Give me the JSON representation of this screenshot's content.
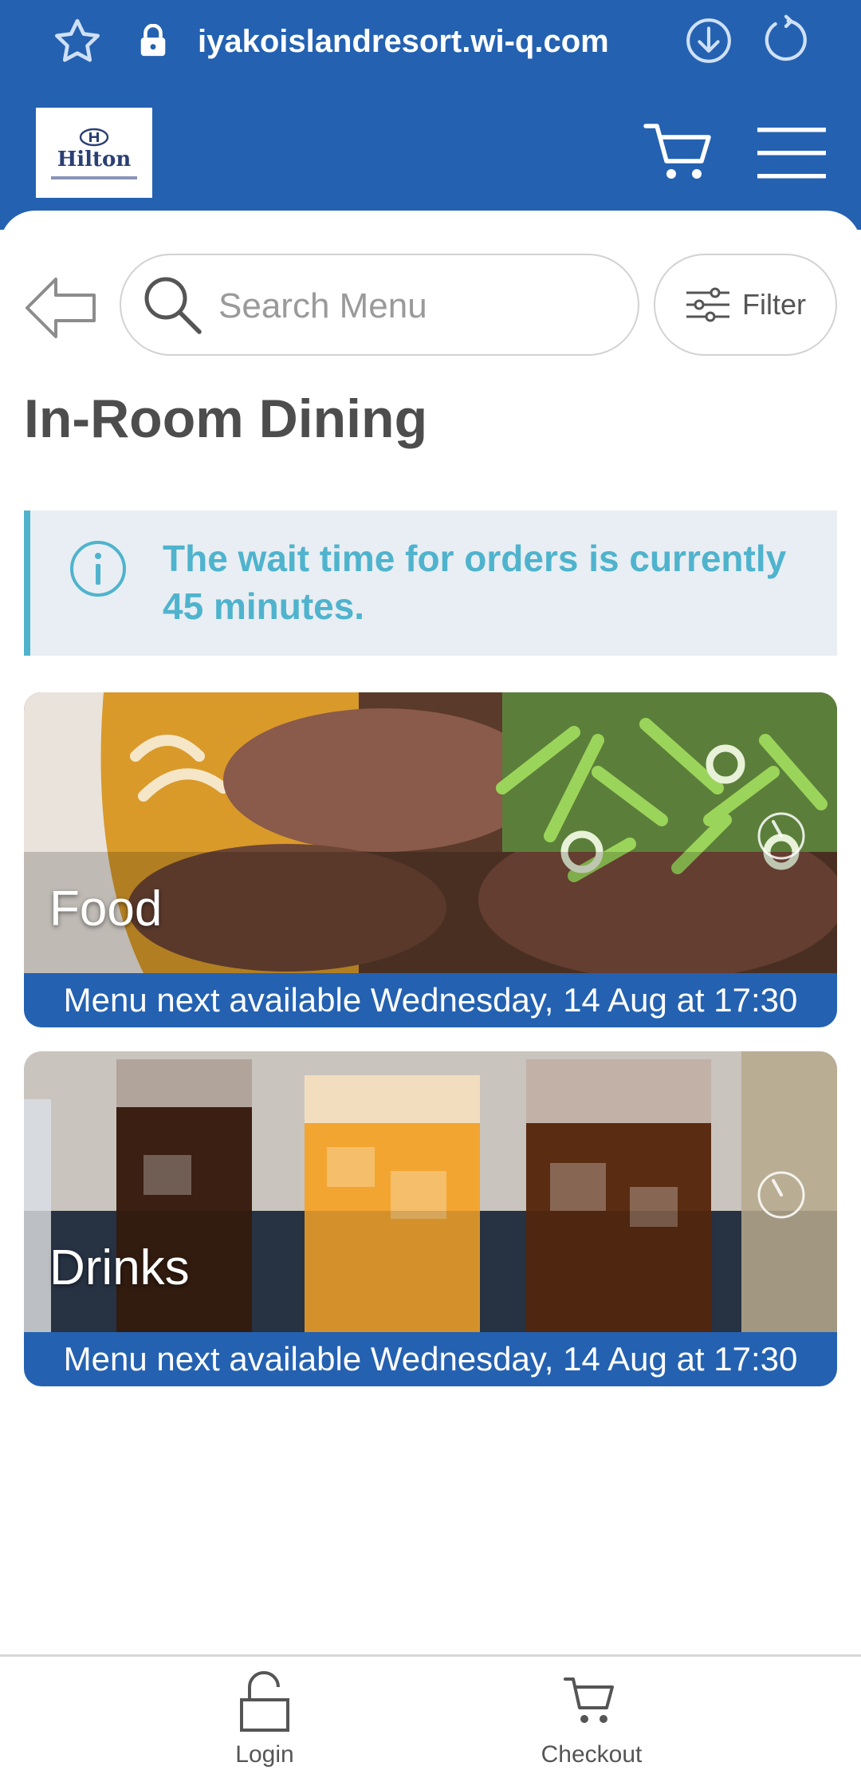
{
  "browser": {
    "url": "iyakoislandresort.wi-q.com"
  },
  "header": {
    "logo_text": "Hilton"
  },
  "search": {
    "placeholder": "Search Menu",
    "filter_label": "Filter"
  },
  "page": {
    "title": "In-Room Dining"
  },
  "alert": {
    "message": "The wait time for orders is currently 45 minutes."
  },
  "menus": [
    {
      "title": "Food",
      "availability": "Menu next available Wednesday, 14 Aug at 17:30",
      "icon": "clock-icon"
    },
    {
      "title": "Drinks",
      "availability": "Menu next available Wednesday, 14 Aug at 17:30",
      "icon": "clock-icon"
    }
  ],
  "bottom_nav": {
    "login_label": "Login",
    "checkout_label": "Checkout"
  },
  "colors": {
    "brand_blue": "#2461b1",
    "info_text": "#4fb3cd",
    "info_bg": "#e8eef3"
  }
}
